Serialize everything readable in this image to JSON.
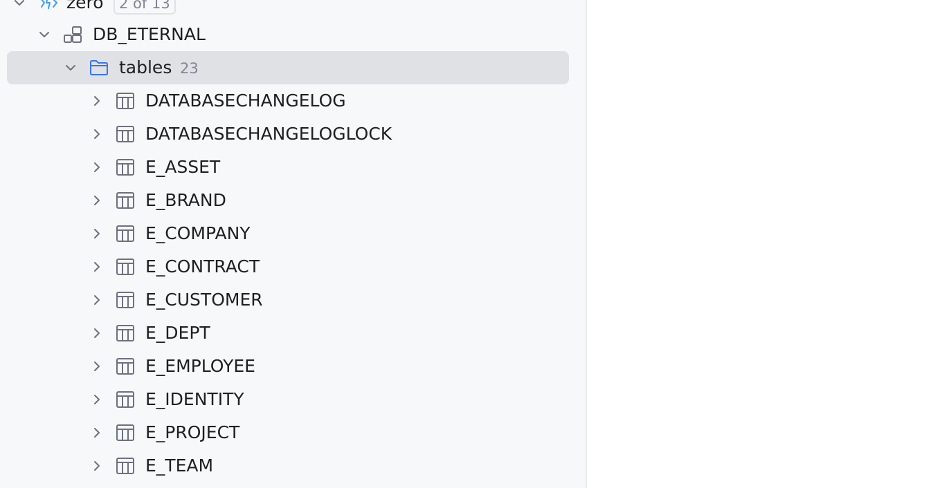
{
  "tree": {
    "connection": {
      "label": "zero",
      "badge": "2 of 13"
    },
    "schema": {
      "label": "DB_ETERNAL"
    },
    "folder": {
      "label": "tables",
      "count": "23"
    },
    "tables": [
      {
        "label": "DATABASECHANGELOG"
      },
      {
        "label": "DATABASECHANGELOGLOCK"
      },
      {
        "label": "E_ASSET"
      },
      {
        "label": "E_BRAND"
      },
      {
        "label": "E_COMPANY"
      },
      {
        "label": "E_CONTRACT"
      },
      {
        "label": "E_CUSTOMER"
      },
      {
        "label": "E_DEPT"
      },
      {
        "label": "E_EMPLOYEE"
      },
      {
        "label": "E_IDENTITY"
      },
      {
        "label": "E_PROJECT"
      },
      {
        "label": "E_TEAM"
      }
    ]
  },
  "icons": {
    "chevron_expanded": "chevron-down-icon",
    "chevron_collapsed": "chevron-right-icon",
    "connection": "connection-icon",
    "schema": "schema-icon",
    "folder": "folder-icon",
    "table": "table-icon"
  },
  "colors": {
    "panel_bg": "#f7f8fa",
    "selected_row": "#dfe1e5",
    "folder_icon": "#3574f0",
    "connection_icon": "#3d9be9",
    "icon_gray": "#6c707e",
    "text": "#1e1f22",
    "muted_text": "#818594"
  }
}
